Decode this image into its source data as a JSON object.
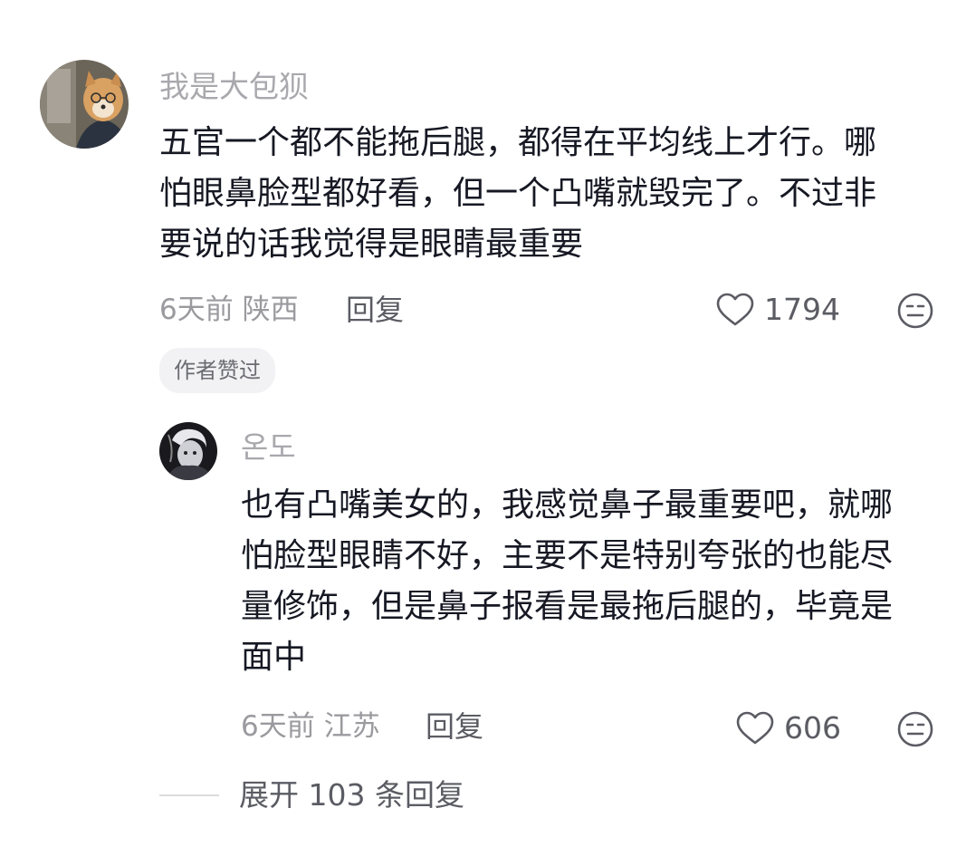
{
  "comment": {
    "username": "我是大包狈",
    "lines": [
      "五官一个都不能拖后腿，都得在平均线上才行。哪",
      "怕眼鼻脸型都好看，但一个凸嘴就毁完了。不过非",
      "要说的话我觉得是眼睛最重要"
    ],
    "time": "6天前",
    "location": "陕西",
    "reply_label": "回复",
    "like_count": "1794",
    "author_badge": "作者赞过"
  },
  "reply": {
    "username": "온도",
    "lines": [
      "也有凸嘴美女的，我感觉鼻子最重要吧，就哪",
      "怕脸型眼睛不好，主要不是特别夸张的也能尽",
      "量修饰，但是鼻子报看是最拖后腿的，毕竟是",
      "面中"
    ],
    "time": "6天前",
    "location": "江苏",
    "reply_label": "回复",
    "like_count": "606"
  },
  "expand_replies": "展开 103 条回复",
  "icons": {
    "like": "heart-outline-icon",
    "dislike": "neutral-face-icon"
  },
  "colors": {
    "text": "#161823",
    "muted": "#a8a8ad",
    "action": "#5b5c63"
  }
}
